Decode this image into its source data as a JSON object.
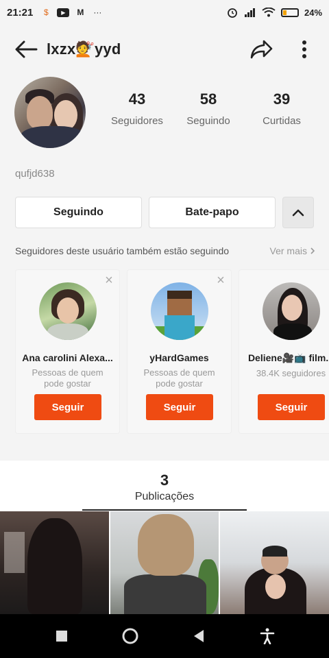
{
  "status_bar": {
    "time": "21:21",
    "battery_text": "24",
    "battery_level": 0.24
  },
  "header": {
    "title": "lxzx💇yyd"
  },
  "profile": {
    "stats": [
      {
        "value": "43",
        "label": "Seguidores"
      },
      {
        "value": "58",
        "label": "Seguindo"
      },
      {
        "value": "39",
        "label": "Curtidas"
      }
    ],
    "handle": "qufjd638"
  },
  "actions": {
    "following_label": "Seguindo",
    "chat_label": "Bate-papo"
  },
  "suggestions": {
    "header": "Seguidores deste usuário também estão seguindo",
    "see_more": "Ver mais",
    "cards": [
      {
        "name": "Ana carolini Alexa...",
        "subtitle": "Pessoas de quem pode gostar",
        "button": "Seguir"
      },
      {
        "name": "yHardGames",
        "subtitle": "Pessoas de quem pode gostar",
        "button": "Seguir"
      },
      {
        "name": "Deliene🎥📺 film...",
        "subtitle": "38.4K seguidores",
        "button": "Seguir"
      }
    ]
  },
  "publications": {
    "count": "3",
    "label": "Publicações"
  },
  "colors": {
    "accent": "#ef4b12",
    "background": "#f4f4f4",
    "navbar": "#000000"
  },
  "icons": [
    "back-arrow-icon",
    "share-icon",
    "more-vert-icon",
    "chevron-up-icon",
    "close-icon",
    "chevron-right-icon",
    "square-icon",
    "home-circle-icon",
    "back-triangle-icon",
    "accessibility-icon"
  ]
}
